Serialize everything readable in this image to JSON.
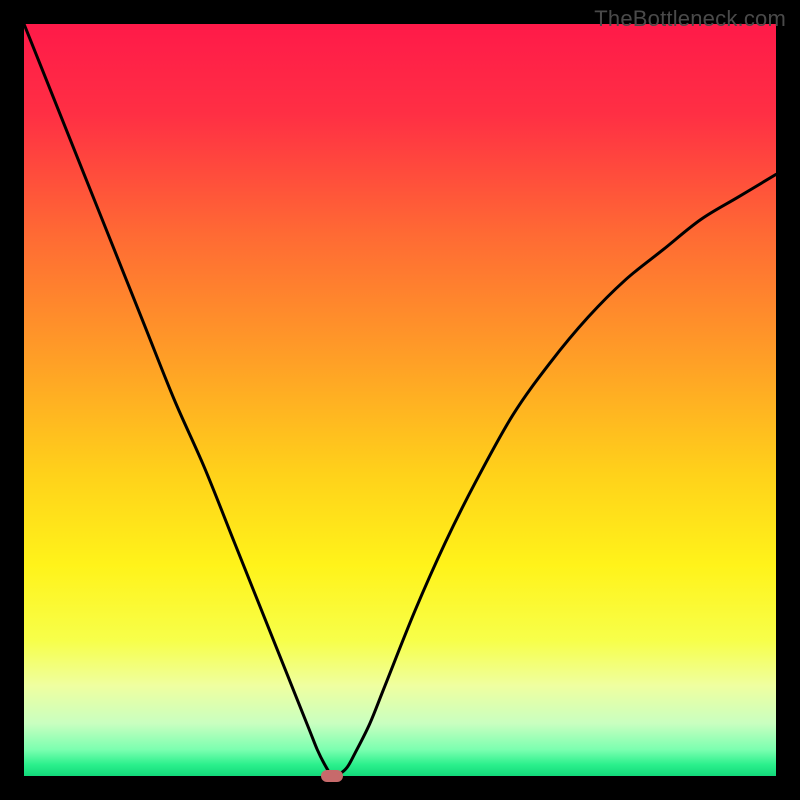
{
  "watermark": "TheBottleneck.com",
  "colors": {
    "gradient_stops": [
      {
        "offset": 0.0,
        "color": "#ff1a49"
      },
      {
        "offset": 0.12,
        "color": "#ff2f44"
      },
      {
        "offset": 0.28,
        "color": "#ff6a34"
      },
      {
        "offset": 0.45,
        "color": "#ffa026"
      },
      {
        "offset": 0.6,
        "color": "#ffd21a"
      },
      {
        "offset": 0.72,
        "color": "#fff31a"
      },
      {
        "offset": 0.82,
        "color": "#f7ff4a"
      },
      {
        "offset": 0.88,
        "color": "#efffa0"
      },
      {
        "offset": 0.93,
        "color": "#c9ffc0"
      },
      {
        "offset": 0.965,
        "color": "#7bffb0"
      },
      {
        "offset": 0.985,
        "color": "#2bf08c"
      },
      {
        "offset": 1.0,
        "color": "#12d87a"
      }
    ],
    "curve": "#000000",
    "marker": "#c76a6b",
    "frame": "#000000"
  },
  "chart_data": {
    "type": "line",
    "title": "",
    "xlabel": "",
    "ylabel": "",
    "xrange": [
      0,
      100
    ],
    "yrange": [
      0,
      100
    ],
    "minimum_point": {
      "x": 41,
      "y": 0
    },
    "series": [
      {
        "name": "bottleneck-curve",
        "x": [
          0,
          4,
          8,
          12,
          16,
          20,
          24,
          28,
          32,
          34,
          36,
          38,
          39,
          40,
          41,
          42,
          43,
          44,
          46,
          48,
          52,
          56,
          60,
          65,
          70,
          75,
          80,
          85,
          90,
          95,
          100
        ],
        "y": [
          100,
          90,
          80,
          70,
          60,
          50,
          41,
          31,
          21,
          16,
          11,
          6,
          3.5,
          1.5,
          0,
          0.3,
          1.2,
          3,
          7,
          12,
          22,
          31,
          39,
          48,
          55,
          61,
          66,
          70,
          74,
          77,
          80
        ]
      }
    ],
    "marker": {
      "x": 41,
      "y": 0
    }
  },
  "plot_geometry": {
    "inner_left": 24,
    "inner_top": 24,
    "inner_width": 752,
    "inner_height": 752
  }
}
